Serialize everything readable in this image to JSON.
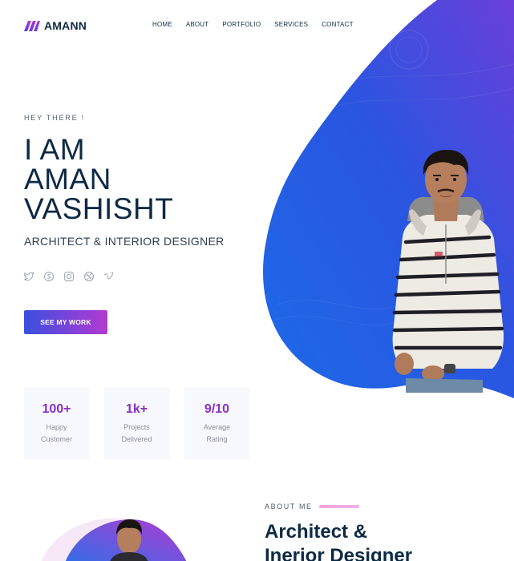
{
  "brand": {
    "name": "AMANN"
  },
  "nav": {
    "items": [
      "HOME",
      "ABOUT",
      "PORTFOLIO",
      "SERVICES",
      "CONTACT"
    ]
  },
  "hero": {
    "eyebrow": "HEY THERE !",
    "name_lines": [
      "I AM",
      "AMAN",
      "VASHISHT"
    ],
    "role": "ARCHITECT & INTERIOR DESIGNER",
    "cta": "SEE MY WORK"
  },
  "socials": [
    "twitter-icon",
    "skype-icon",
    "instagram-icon",
    "dribbble-icon",
    "vimeo-icon"
  ],
  "stats": [
    {
      "value": "100+",
      "label_line1": "Happy",
      "label_line2": "Customer"
    },
    {
      "value": "1k+",
      "label_line1": "Projects",
      "label_line2": "Delivered"
    },
    {
      "value": "9/10",
      "label_line1": "Average",
      "label_line2": "Rating"
    }
  ],
  "about": {
    "eyebrow": "ABOUT ME",
    "title_line1": "Architect &",
    "title_line2": "Inerior Designer"
  },
  "colors": {
    "navy": "#0d2a45",
    "blob_start": "#1f5be6",
    "blob_end": "#6a3fd9",
    "accent_purple": "#8a2fc3",
    "cta_start": "#3a4fe0",
    "cta_end": "#b23ad0"
  }
}
